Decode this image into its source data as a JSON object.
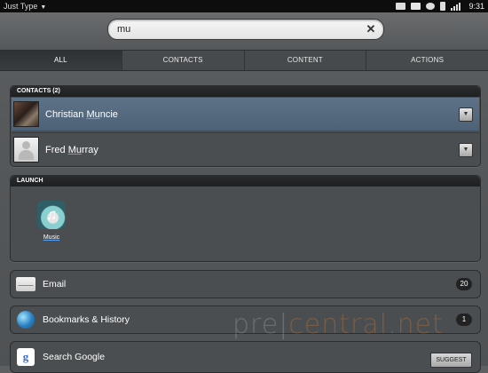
{
  "status_bar": {
    "app_name": "Just Type",
    "time": "9:31"
  },
  "search": {
    "value": "mu"
  },
  "tabs": [
    {
      "label": "ALL",
      "active": true
    },
    {
      "label": "CONTACTS",
      "active": false
    },
    {
      "label": "CONTENT",
      "active": false
    },
    {
      "label": "ACTIONS",
      "active": false
    }
  ],
  "contacts_section": {
    "header": "CONTACTS (2)",
    "items": [
      {
        "name_before": "Christian ",
        "name_match": "Mu",
        "name_after": "ncie",
        "selected": true
      },
      {
        "name_before": "Fred ",
        "name_match": "Mu",
        "name_after": "rray",
        "selected": false
      }
    ]
  },
  "launch_section": {
    "header": "LAUNCH",
    "apps": [
      {
        "label_match": "Mu",
        "label_after": "sic"
      }
    ]
  },
  "actions": {
    "email": {
      "label": "Email",
      "count": "20"
    },
    "bookmarks": {
      "label": "Bookmarks & History",
      "count": "1"
    },
    "google": {
      "label": "Search Google",
      "button": "SUGGEST"
    }
  },
  "watermark": {
    "part1": "pre",
    "part2": "central.net"
  },
  "colors": {
    "selected_row": "#5d7287",
    "match_underline": "#4fa0ff"
  }
}
